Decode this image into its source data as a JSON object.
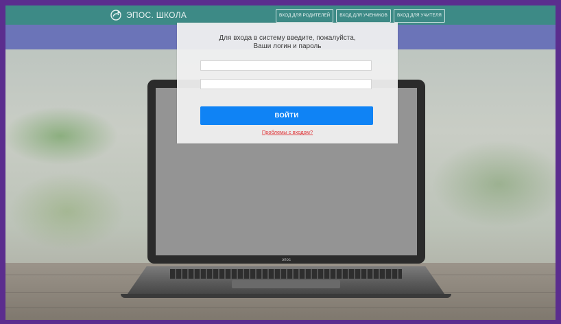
{
  "brand": {
    "name": "ЭПОС. ШКОЛА",
    "icon": "epos-logo-icon"
  },
  "nav": {
    "items": [
      {
        "label": "ВХОД ДЛЯ РОДИТЕЛЕЙ"
      },
      {
        "label": "ВХОД ДЛЯ УЧЕНИКОВ"
      },
      {
        "label": "ВХОД ДЛЯ УЧИТЕЛЯ"
      }
    ]
  },
  "login": {
    "prompt_line1": "Для входа в систему введите, пожалуйста,",
    "prompt_line2": "Ваши логин и пароль",
    "username_value": "",
    "password_value": "",
    "submit_label": "ВОЙТИ",
    "trouble_link": "Проблемы с входом?"
  },
  "laptop": {
    "logo_text": "эпос"
  },
  "colors": {
    "header": "#3d8a86",
    "subbar": "#6b74b8",
    "accent": "#0f83f5",
    "link": "#e0373a"
  }
}
